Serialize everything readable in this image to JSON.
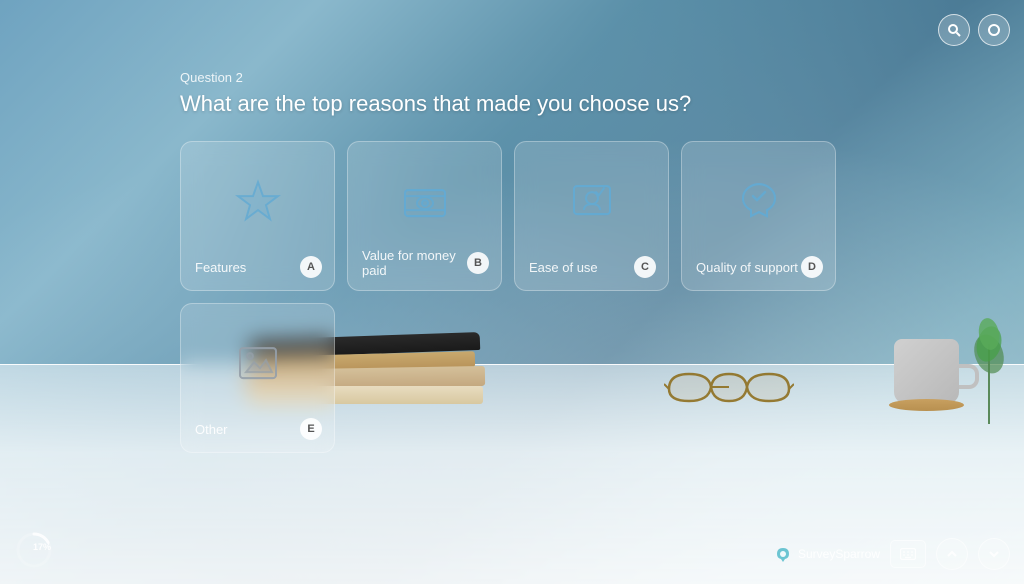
{
  "question": {
    "number": "Question 2",
    "text": "What are the top reasons that made you choose us?"
  },
  "options": [
    {
      "id": "A",
      "label": "Features",
      "icon": "star"
    },
    {
      "id": "B",
      "label": "Value for money paid",
      "icon": "money"
    },
    {
      "id": "C",
      "label": "Ease of use",
      "icon": "ease"
    },
    {
      "id": "D",
      "label": "Quality of support",
      "icon": "support"
    },
    {
      "id": "E",
      "label": "Other",
      "icon": "image"
    }
  ],
  "progress": {
    "percent": "17%",
    "value": 17
  },
  "branding": {
    "name": "SurveySparrow"
  },
  "topButtons": {
    "search": "🔍",
    "circle": "○"
  }
}
